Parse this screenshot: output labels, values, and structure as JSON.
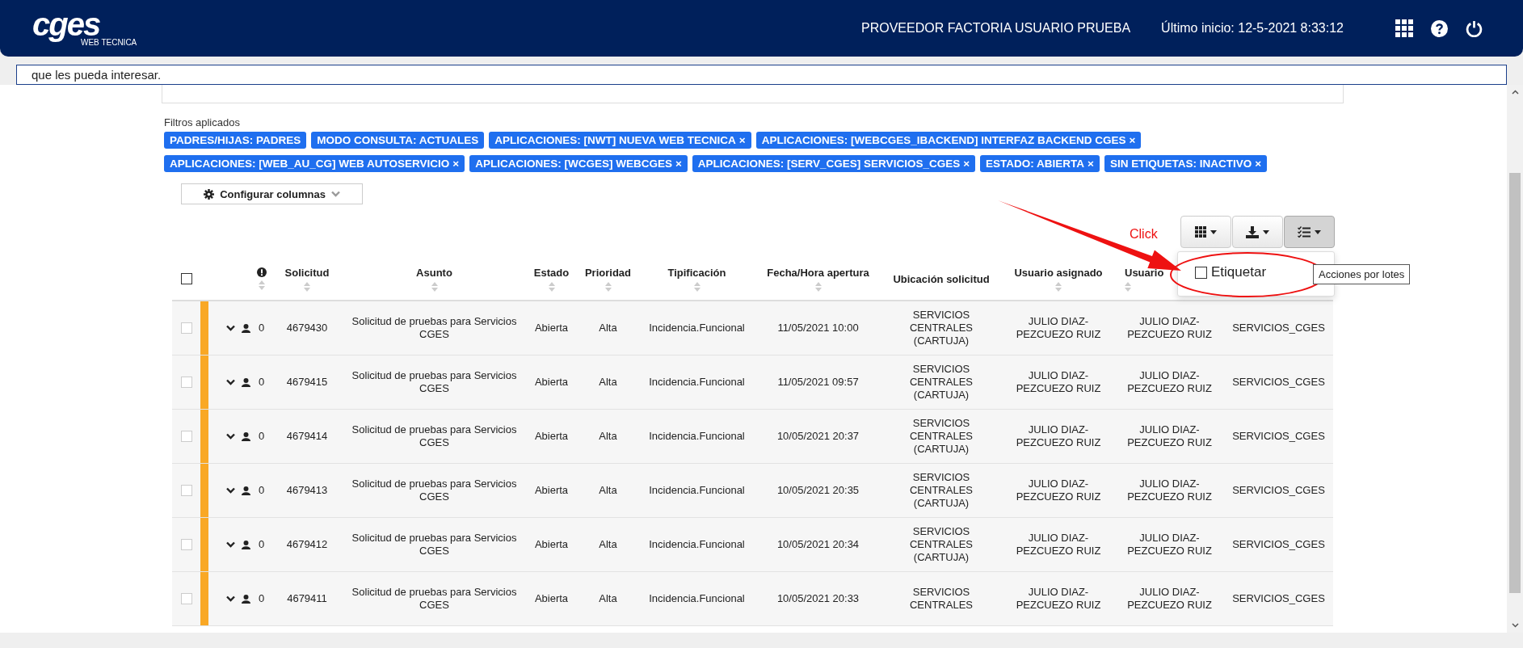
{
  "header": {
    "logo_text": "cges",
    "logo_subtext": "WEB TECNICA",
    "user": "PROVEEDOR FACTORIA USUARIO PRUEBA",
    "last_login": "Último inicio: 12-5-2021 8:33:12"
  },
  "notice_field": {
    "value": "que les pueda interesar."
  },
  "filters": {
    "label": "Filtros aplicados",
    "tags": [
      {
        "label": "PADRES/HIJAS: PADRES"
      },
      {
        "label": "MODO CONSULTA: ACTUALES"
      },
      {
        "label": "APLICACIONES: [NWT] NUEVA WEB TECNICA",
        "remove": "×"
      },
      {
        "label": "APLICACIONES: [WEBCGES_IBACKEND] INTERFAZ BACKEND CGES",
        "remove": "×"
      },
      {
        "label": "APLICACIONES: [WEB_AU_CG] WEB AUTOSERVICIO",
        "remove": "×"
      },
      {
        "label": "APLICACIONES: [WCGES] WEBCGES",
        "remove": "×"
      },
      {
        "label": "APLICACIONES: [SERV_CGES] SERVICIOS_CGES",
        "remove": "×"
      },
      {
        "label": "ESTADO: ABIERTA",
        "remove": "×"
      },
      {
        "label": "SIN ETIQUETAS: INACTIVO",
        "remove": "×"
      }
    ]
  },
  "config_button": {
    "label": "Configurar columnas"
  },
  "annotation": {
    "label": "Click"
  },
  "toolbar": [
    {
      "kind": "grid",
      "pressed": false
    },
    {
      "kind": "download",
      "pressed": false
    },
    {
      "kind": "checklist",
      "pressed": true
    }
  ],
  "dropdown": {
    "items": [
      {
        "label": "Etiquetar",
        "checked": false
      }
    ]
  },
  "tooltip": "Acciones por lotes",
  "table": {
    "columns": [
      {
        "kind": "select",
        "checked": false
      },
      {
        "kind": "spacer"
      },
      {
        "kind": "spacer"
      },
      {
        "kind": "alert",
        "sortable": true
      },
      {
        "kind": "text",
        "label": "Solicitud",
        "sortable": true
      },
      {
        "kind": "text",
        "label": "Asunto",
        "sortable": true
      },
      {
        "kind": "text",
        "label": "Estado",
        "sortable": true
      },
      {
        "kind": "text",
        "label": "Prioridad",
        "sortable": true
      },
      {
        "kind": "text",
        "label": "Tipificación",
        "sortable": true
      },
      {
        "kind": "text",
        "label": "Fecha/Hora apertura",
        "sortable": true
      },
      {
        "kind": "text",
        "label": "Ubicación solicitud",
        "sortable": false
      },
      {
        "kind": "text",
        "label": "Usuario asignado",
        "sortable": true
      },
      {
        "kind": "text",
        "label": "Usuario",
        "sortable": true
      },
      {
        "kind": "spacer"
      }
    ],
    "rows": [
      {
        "checked": false,
        "color": "#f9a825",
        "count": "0",
        "id": "4679430",
        "subject": "Solicitud de pruebas para Servicios CGES",
        "status": "Abierta",
        "priority": "Alta",
        "type": "Incidencia.Funcional",
        "opened": "11/05/2021 10:00",
        "location": "SERVICIOS CENTRALES (CARTUJA)",
        "assigned": "JULIO DIAZ-PEZCUEZO RUIZ",
        "user": "JULIO DIAZ-PEZCUEZO RUIZ",
        "group": "SERVICIOS_CGES"
      },
      {
        "checked": false,
        "color": "#f9a825",
        "count": "0",
        "id": "4679415",
        "subject": "Solicitud de pruebas para Servicios CGES",
        "status": "Abierta",
        "priority": "Alta",
        "type": "Incidencia.Funcional",
        "opened": "11/05/2021 09:57",
        "location": "SERVICIOS CENTRALES (CARTUJA)",
        "assigned": "JULIO DIAZ-PEZCUEZO RUIZ",
        "user": "JULIO DIAZ-PEZCUEZO RUIZ",
        "group": "SERVICIOS_CGES"
      },
      {
        "checked": false,
        "color": "#f9a825",
        "count": "0",
        "id": "4679414",
        "subject": "Solicitud de pruebas para Servicios CGES",
        "status": "Abierta",
        "priority": "Alta",
        "type": "Incidencia.Funcional",
        "opened": "10/05/2021 20:37",
        "location": "SERVICIOS CENTRALES (CARTUJA)",
        "assigned": "JULIO DIAZ-PEZCUEZO RUIZ",
        "user": "JULIO DIAZ-PEZCUEZO RUIZ",
        "group": "SERVICIOS_CGES"
      },
      {
        "checked": false,
        "color": "#f9a825",
        "count": "0",
        "id": "4679413",
        "subject": "Solicitud de pruebas para Servicios CGES",
        "status": "Abierta",
        "priority": "Alta",
        "type": "Incidencia.Funcional",
        "opened": "10/05/2021 20:35",
        "location": "SERVICIOS CENTRALES (CARTUJA)",
        "assigned": "JULIO DIAZ-PEZCUEZO RUIZ",
        "user": "JULIO DIAZ-PEZCUEZO RUIZ",
        "group": "SERVICIOS_CGES"
      },
      {
        "checked": false,
        "color": "#f9a825",
        "count": "0",
        "id": "4679412",
        "subject": "Solicitud de pruebas para Servicios CGES",
        "status": "Abierta",
        "priority": "Alta",
        "type": "Incidencia.Funcional",
        "opened": "10/05/2021 20:34",
        "location": "SERVICIOS CENTRALES (CARTUJA)",
        "assigned": "JULIO DIAZ-PEZCUEZO RUIZ",
        "user": "JULIO DIAZ-PEZCUEZO RUIZ",
        "group": "SERVICIOS_CGES"
      },
      {
        "checked": false,
        "color": "#f9a825",
        "count": "0",
        "id": "4679411",
        "subject": "Solicitud de pruebas para Servicios CGES",
        "status": "Abierta",
        "priority": "Alta",
        "type": "Incidencia.Funcional",
        "opened": "10/05/2021 20:33",
        "location": "SERVICIOS CENTRALES",
        "assigned": "JULIO DIAZ-PEZCUEZO RUIZ",
        "user": "JULIO DIAZ-PEZCUEZO RUIZ",
        "group": "SERVICIOS_CGES"
      }
    ]
  }
}
